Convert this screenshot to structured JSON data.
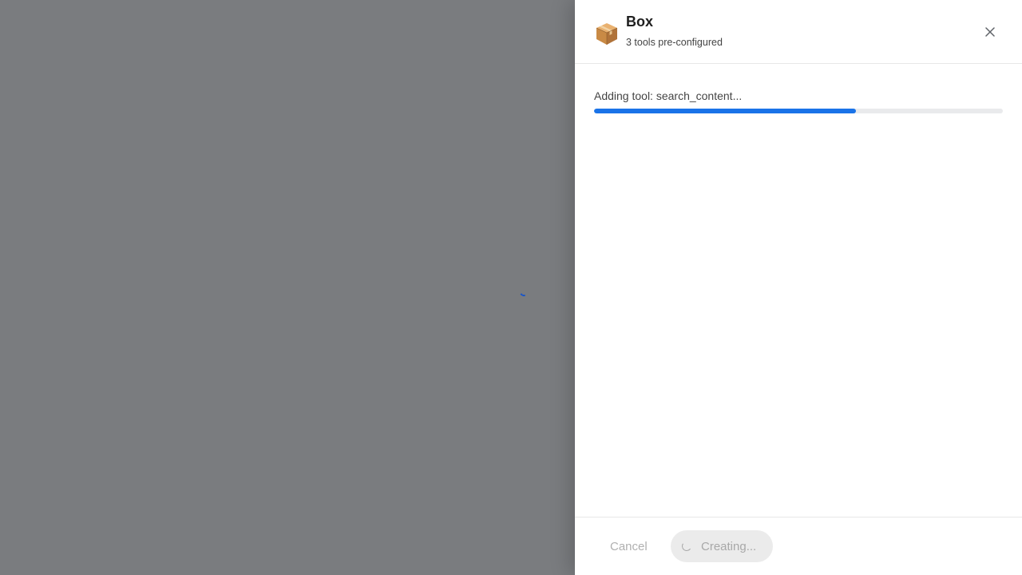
{
  "app": {
    "title": "Box",
    "subtitle": "3 tools pre-configured",
    "icon": "package-box-icon"
  },
  "progress": {
    "status": "Adding tool: search_content...",
    "fraction": 0.64,
    "color": "#1a73e8"
  },
  "footer": {
    "cancel_label": "Cancel",
    "create_label": "Creating..."
  },
  "colors": {
    "backdrop": "#7a7c7f",
    "accent": "#1a73e8"
  }
}
